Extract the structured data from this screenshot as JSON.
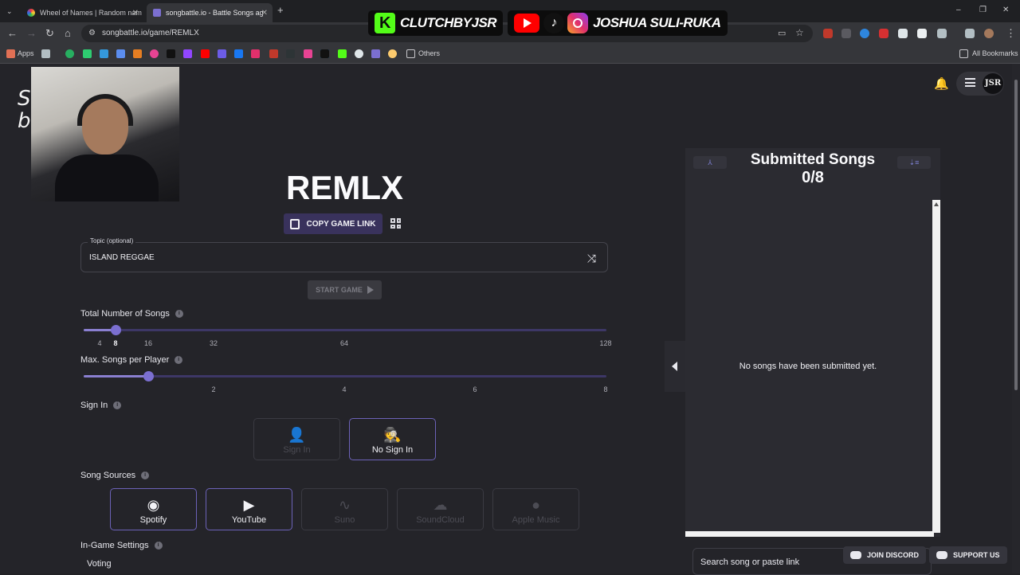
{
  "browser": {
    "tabs": [
      {
        "title": "Wheel of Names | Random nam",
        "active": false
      },
      {
        "title": "songbattle.io - Battle Songs ag",
        "active": true
      }
    ],
    "url": "songbattle.io/game/REMLX",
    "bookmarks": {
      "apps_label": "Apps",
      "others_label": "Others",
      "all_label": "All Bookmarks"
    }
  },
  "stream_overlay": {
    "kick_name": "CLUTCHBYJSR",
    "social_name": "JOSHUA SULI-RUKA"
  },
  "site": {
    "logo_text": "So\nb",
    "avatar_text": "JSR"
  },
  "game": {
    "room_code": "REMLX",
    "copy_label": "COPY GAME LINK",
    "topic_label": "Topic (optional)",
    "topic_value": "ISLAND REGGAE",
    "start_label": "START GAME"
  },
  "settings": {
    "total_songs": {
      "label": "Total Number of Songs",
      "ticks": [
        "4",
        "8",
        "16",
        "32",
        "64",
        "128"
      ],
      "value": "8"
    },
    "max_per_player": {
      "label": "Max. Songs per Player",
      "ticks": [
        "2",
        "4",
        "6",
        "8"
      ],
      "value": 1
    },
    "sign_in": {
      "label": "Sign In",
      "options": [
        {
          "label": "Sign In",
          "selected": false
        },
        {
          "label": "No Sign In",
          "selected": true
        }
      ]
    },
    "sources": {
      "label": "Song Sources",
      "options": [
        {
          "label": "Spotify",
          "selected": true
        },
        {
          "label": "YouTube",
          "selected": true
        },
        {
          "label": "Suno",
          "selected": false
        },
        {
          "label": "SoundCloud",
          "selected": false
        },
        {
          "label": "Apple Music",
          "selected": false
        }
      ]
    },
    "in_game_label": "In-Game Settings",
    "voting_label": "Voting"
  },
  "panel": {
    "title": "Submitted Songs",
    "count": "0/8",
    "empty_text": "No songs have been submitted yet.",
    "search_placeholder": "Search song or paste link"
  },
  "floating": {
    "discord": "JOIN DISCORD",
    "support": "SUPPORT US"
  },
  "colors": {
    "accent": "#7b6fd0",
    "background": "#242429",
    "panel": "#2b2b31"
  }
}
